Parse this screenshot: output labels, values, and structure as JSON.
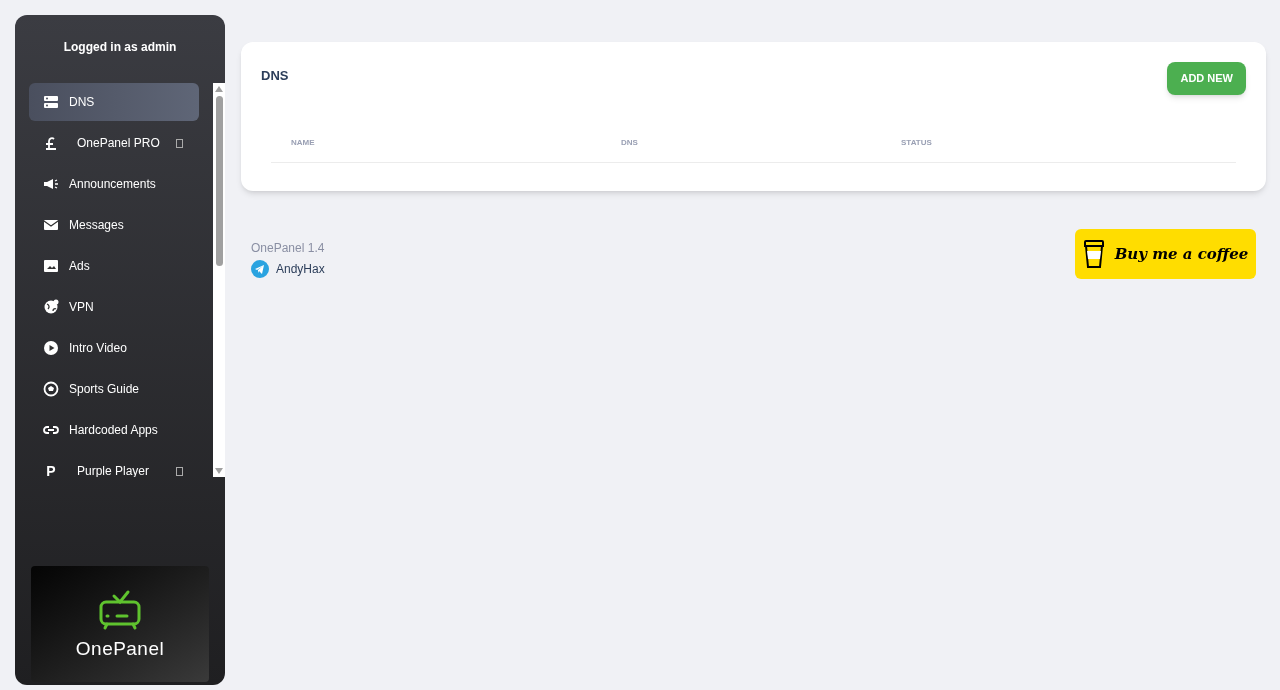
{
  "sidebar": {
    "user_label": "Logged in as admin",
    "items": [
      {
        "label": "DNS",
        "kind": "link",
        "selected": true
      },
      {
        "label": "OnePanel PRO",
        "kind": "group",
        "selected": false
      },
      {
        "label": "Announcements",
        "kind": "link",
        "selected": false
      },
      {
        "label": "Messages",
        "kind": "link",
        "selected": false
      },
      {
        "label": "Ads",
        "kind": "link",
        "selected": false
      },
      {
        "label": "VPN",
        "kind": "link",
        "selected": false
      },
      {
        "label": "Intro Video",
        "kind": "link",
        "selected": false
      },
      {
        "label": "Sports Guide",
        "kind": "link",
        "selected": false
      },
      {
        "label": "Hardcoded Apps",
        "kind": "link",
        "selected": false
      },
      {
        "label": "Purple Player",
        "icon_text": "P",
        "kind": "group",
        "selected": false
      }
    ],
    "logo_text": "OnePanel"
  },
  "card": {
    "title": "DNS",
    "add_button": "ADD NEW",
    "columns": [
      "NAME",
      "DNS",
      "STATUS"
    ]
  },
  "footer": {
    "version": "OnePanel 1.4",
    "author": "AndyHax",
    "coffee_button": "Buy me a coffee"
  }
}
